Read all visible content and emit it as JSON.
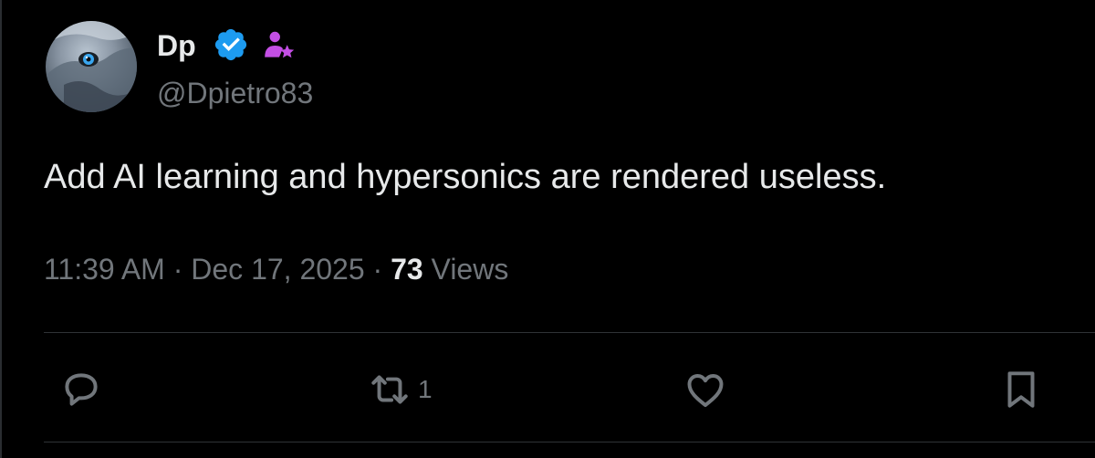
{
  "author": {
    "display_name": "Dp",
    "handle": "@Dpietro83",
    "avatar_icon": "wolf-avatar",
    "badges": [
      "verified-badge-icon",
      "affiliate-badge-icon"
    ]
  },
  "post": {
    "text": "Add AI learning and hypersonics are rendered useless."
  },
  "meta": {
    "time": "11:39 AM",
    "separator": "·",
    "date": "Dec 17, 2025",
    "views_count": "73",
    "views_label": "Views"
  },
  "actions": {
    "reply_icon": "reply-icon",
    "repost_icon": "repost-icon",
    "repost_count": "1",
    "like_icon": "heart-icon",
    "bookmark_icon": "bookmark-icon"
  },
  "colors": {
    "background": "#000000",
    "text_primary": "#e7e9ea",
    "text_secondary": "#71767b",
    "verified_blue": "#1d9bf0",
    "affiliate_purple": "#c44fe5",
    "divider": "#2f3336"
  }
}
